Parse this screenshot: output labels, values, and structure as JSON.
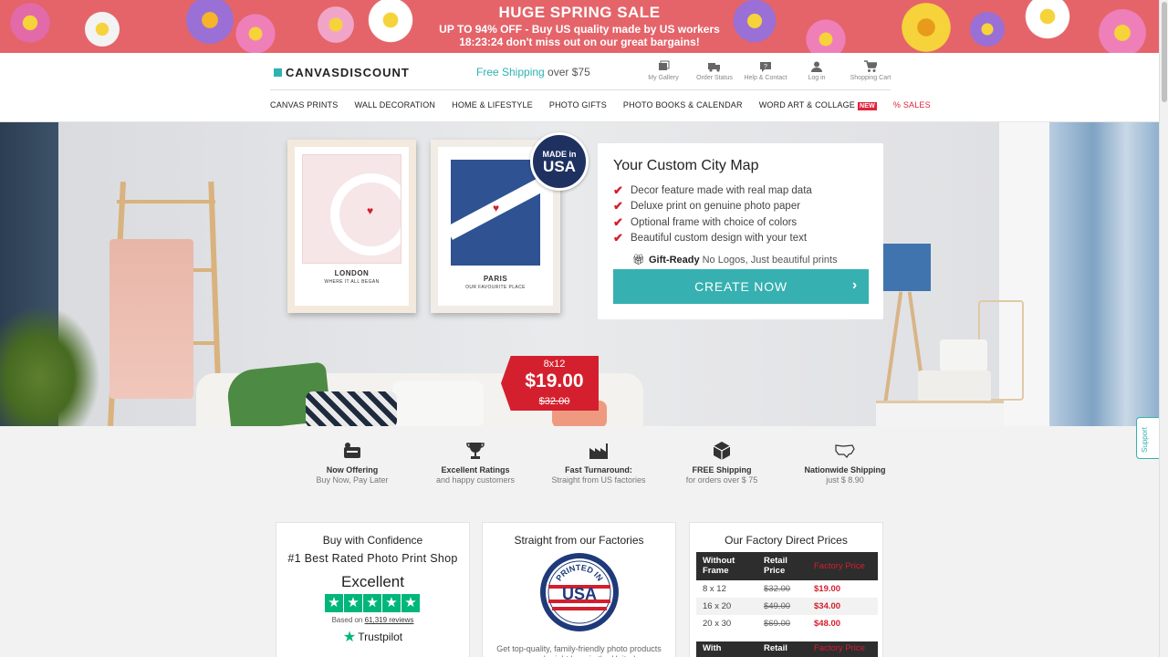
{
  "promo": {
    "title": "HUGE SPRING SALE",
    "line2": "UP TO 94% OFF - Buy US quality made by US workers",
    "countdown": "18:23:24",
    "line3_rest": " don't miss out on our great bargains!"
  },
  "header": {
    "logo": "CANVASDISCOUNT",
    "free_shipping_teal": "Free Shipping",
    "free_shipping_rest": " over $75",
    "icons": [
      {
        "label": "My Gallery",
        "icon": "gallery-icon"
      },
      {
        "label": "Order Status",
        "icon": "truck-icon"
      },
      {
        "label": "Help & Contact",
        "icon": "help-icon"
      },
      {
        "label": "Log in",
        "icon": "user-icon"
      },
      {
        "label": "Shopping Cart",
        "icon": "cart-icon"
      }
    ]
  },
  "nav": {
    "items": [
      "CANVAS PRINTS",
      "WALL DECORATION",
      "HOME & LIFESTYLE",
      "PHOTO GIFTS",
      "PHOTO BOOKS & CALENDAR",
      "WORD ART & COLLAGE"
    ],
    "new_badge": "NEW",
    "sales": "% SALES"
  },
  "hero": {
    "frame1": {
      "city": "LONDON",
      "sub": "WHERE IT ALL BEGAN"
    },
    "frame2": {
      "city": "PARIS",
      "sub": "OUR FAVOURITE PLACE"
    },
    "seal": {
      "line1": "MADE in",
      "line2": "USA"
    },
    "card": {
      "title": "Your Custom City Map",
      "bullets": [
        "Decor feature made with real map data",
        "Deluxe print on genuine photo paper",
        "Optional frame with choice of colors",
        "Beautiful custom design with your text"
      ],
      "gift_bold": "Gift-Ready",
      "gift_rest": "No Logos, Just beautiful prints",
      "cta": "CREATE NOW"
    },
    "price_tag": {
      "size": "8x12",
      "price": "$19.00",
      "old_price": "$32.00"
    }
  },
  "support_label": "Support",
  "features": [
    {
      "icon": "pay-later-icon",
      "title": "Now Offering",
      "sub": "Buy Now, Pay Later"
    },
    {
      "icon": "trophy-icon",
      "title": "Excellent Ratings",
      "sub": "and happy customers"
    },
    {
      "icon": "factory-icon",
      "title": "Fast Turnaround:",
      "sub": "Straight from US factories"
    },
    {
      "icon": "package-icon",
      "title": "FREE Shipping",
      "sub": "for orders over $ 75"
    },
    {
      "icon": "us-map-icon",
      "title": "Nationwide Shipping",
      "sub": "just $ 8.90"
    }
  ],
  "confidence": {
    "heading": "Buy with Confidence",
    "subheading": "#1 Best Rated Photo Print Shop",
    "rating_word": "Excellent",
    "based_prefix": "Based on ",
    "reviews_link": "61,319 reviews",
    "trustpilot": "Trustpilot"
  },
  "factories": {
    "heading": "Straight from our Factories",
    "seal_top": "PRINTED IN",
    "seal_main": "USA",
    "desc": "Get top-quality, family-friendly photo products – made right here in the United"
  },
  "prices": {
    "heading": "Our Factory Direct Prices",
    "headers": [
      "Without Frame",
      "Retail Price",
      "Factory Price"
    ],
    "rows": [
      {
        "size": "8 x 12",
        "retail": "$32.00",
        "factory": "$19.00"
      },
      {
        "size": "16 x 20",
        "retail": "$49.00",
        "factory": "$34.00"
      },
      {
        "size": "20 x 30",
        "retail": "$69.00",
        "factory": "$48.00"
      }
    ],
    "headers2": [
      "With",
      "Retail",
      "Factory Price"
    ]
  },
  "colors": {
    "promo_bg": "#e4646a",
    "teal": "#36b0b0",
    "red": "#d41e2e",
    "trustpilot_green": "#00b67a"
  }
}
